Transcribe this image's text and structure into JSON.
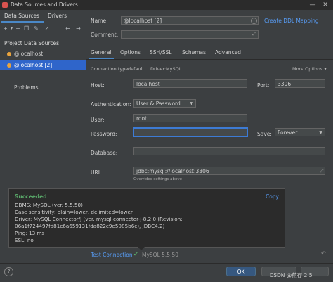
{
  "window": {
    "title": "Data Sources and Drivers"
  },
  "left": {
    "tabs": [
      "Data Sources",
      "Drivers"
    ],
    "section_header": "Project Data Sources",
    "items": [
      "@localhost",
      "@localhost [2]"
    ],
    "problems": "Problems"
  },
  "form": {
    "name_label": "Name:",
    "name_value": "@localhost [2]",
    "create_ddl": "Create DDL Mapping",
    "comment_label": "Comment:",
    "tabs": [
      "General",
      "Options",
      "SSH/SSL",
      "Schemas",
      "Advanced"
    ],
    "connection_type_label": "Connection type:",
    "connection_type_value": "default",
    "driver_label": "Driver:",
    "driver_value": "MySQL",
    "more_options": "More Options",
    "host_label": "Host:",
    "host_value": "localhost",
    "port_label": "Port:",
    "port_value": "3306",
    "auth_label": "Authentication:",
    "auth_value": "User & Password",
    "user_label": "User:",
    "user_value": "root",
    "password_label": "Password:",
    "save_label": "Save:",
    "save_value": "Forever",
    "database_label": "Database:",
    "url_label": "URL:",
    "url_value": "jdbc:mysql://localhost:3306",
    "url_hint": "Overrides settings above"
  },
  "popup": {
    "status": "Succeeded",
    "copy": "Copy",
    "lines": [
      "DBMS: MySQL (ver. 5.5.50)",
      "Case sensitivity: plain=lower, delimited=lower",
      "Driver: MySQL Connector/J (ver. mysql-connector-j-8.2.0 (Revision:",
      "06a1f724497fd81c6a659131fda822c9e5085b6c), JDBC4.2)",
      "Ping: 13 ms",
      "SSL: no"
    ]
  },
  "footer": {
    "test_connection": "Test Connection",
    "test_result": "MySQL 5.5.50",
    "ok": "OK",
    "watermark": "CSDN @煎存 2.5"
  },
  "colors": {
    "accent": "#4a88c7",
    "link": "#589df6",
    "success": "#59a869",
    "selected": "#2f65ca"
  }
}
